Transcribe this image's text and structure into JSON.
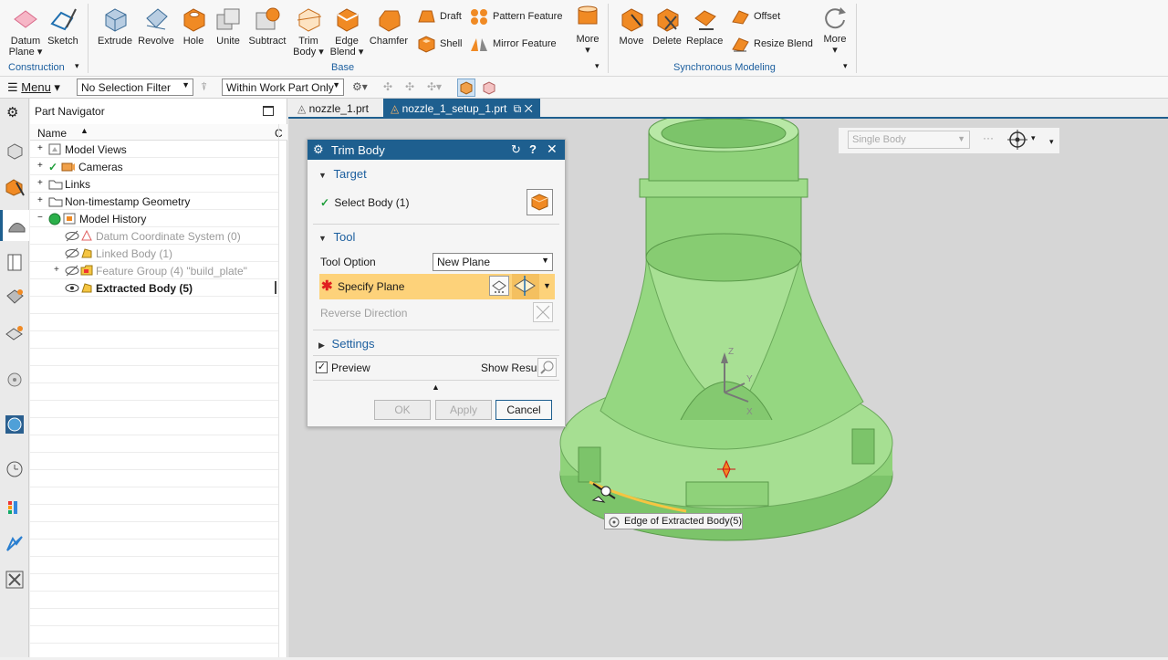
{
  "ribbon": {
    "construction": {
      "datum_plane": "Datum Plane",
      "sketch": "Sketch",
      "group_label": "Construction"
    },
    "base": {
      "extrude": "Extrude",
      "revolve": "Revolve",
      "hole": "Hole",
      "unite": "Unite",
      "subtract": "Subtract",
      "trim_body": "Trim Body",
      "edge_blend": "Edge Blend",
      "chamfer": "Chamfer",
      "draft": "Draft",
      "shell": "Shell",
      "pattern_feature": "Pattern Feature",
      "mirror_feature": "Mirror Feature",
      "more": "More",
      "group_label": "Base"
    },
    "synchronous": {
      "move": "Move",
      "delete": "Delete",
      "replace": "Replace",
      "offset": "Offset",
      "resize_blend": "Resize Blend",
      "more": "More",
      "group_label": "Synchronous Modeling"
    }
  },
  "toolbar": {
    "menu": "Menu",
    "selection_filter": "No Selection Filter",
    "scope": "Within Work Part Only"
  },
  "navigator": {
    "title": "Part Navigator",
    "column_name": "Name",
    "column_c": "C",
    "rows": [
      {
        "label": "Model Views"
      },
      {
        "label": "Cameras"
      },
      {
        "label": "Links"
      },
      {
        "label": "Non-timestamp Geometry"
      },
      {
        "label": "Model History"
      },
      {
        "label": "Datum Coordinate System (0)"
      },
      {
        "label": "Linked Body (1)"
      },
      {
        "label": "Feature Group (4) \"build_plate\""
      },
      {
        "label": "Extracted Body (5)"
      }
    ]
  },
  "tabs": [
    {
      "label": "nozzle_1.prt"
    },
    {
      "label": "nozzle_1_setup_1.prt"
    }
  ],
  "dialog": {
    "title": "Trim Body",
    "target_section": "Target",
    "select_body": "Select Body (1)",
    "tool_section": "Tool",
    "tool_option_label": "Tool Option",
    "tool_option_value": "New Plane",
    "specify_plane": "Specify Plane",
    "reverse_direction": "Reverse Direction",
    "settings_section": "Settings",
    "preview": "Preview",
    "show_result": "Show Result",
    "ok": "OK",
    "apply": "Apply",
    "cancel": "Cancel"
  },
  "viewport": {
    "body_filter": "Single Body",
    "tooltip": "Edge of Extracted Body(5)",
    "axis_x": "X",
    "axis_y": "Y",
    "axis_z": "Z"
  },
  "colors": {
    "accent": "#1e5f8f",
    "highlight": "#fdd27a",
    "model": "#8fd27a",
    "icon_orange": "#f08a24"
  }
}
